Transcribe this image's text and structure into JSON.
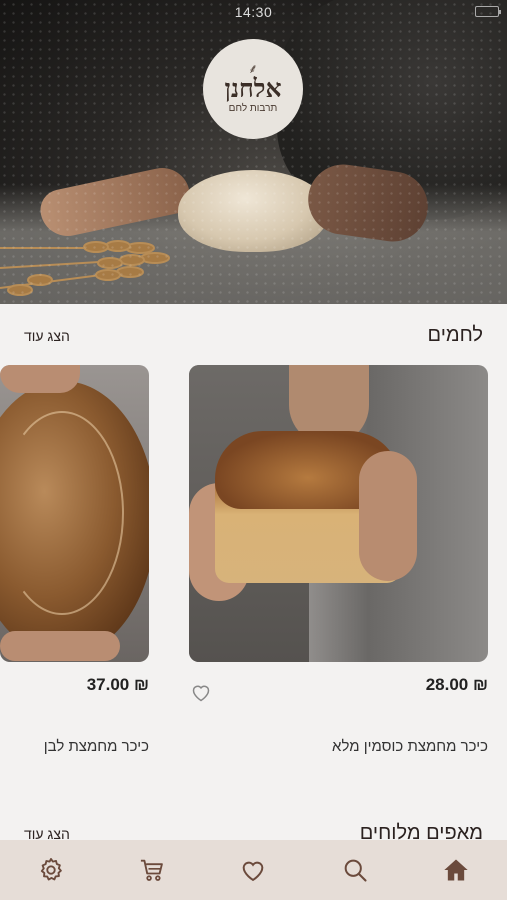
{
  "status_bar": {
    "time": "14:30"
  },
  "logo": {
    "mark": "⸙",
    "name": "אלחנן",
    "tagline": "תרבות לחם"
  },
  "sections": [
    {
      "title": "לחמים",
      "show_more": "הצג עוד",
      "products": [
        {
          "name": "כיכר מחמצת כוסמין מלא",
          "price": "28.00 ₪",
          "favorite": false
        },
        {
          "name": "כיכר מחמצת לבן",
          "price": "37.00 ₪",
          "favorite": false
        }
      ]
    },
    {
      "title": "מאפים מלוחים",
      "show_more": "הצג עוד"
    }
  ],
  "bottom_nav": {
    "items": [
      "settings-icon",
      "cart-icon",
      "heart-icon",
      "search-icon",
      "home-icon"
    ],
    "active": "home-icon",
    "colors": {
      "icon": "#6b4a3c",
      "active": "#6b4a3c",
      "background": "#e6ddd7"
    }
  }
}
